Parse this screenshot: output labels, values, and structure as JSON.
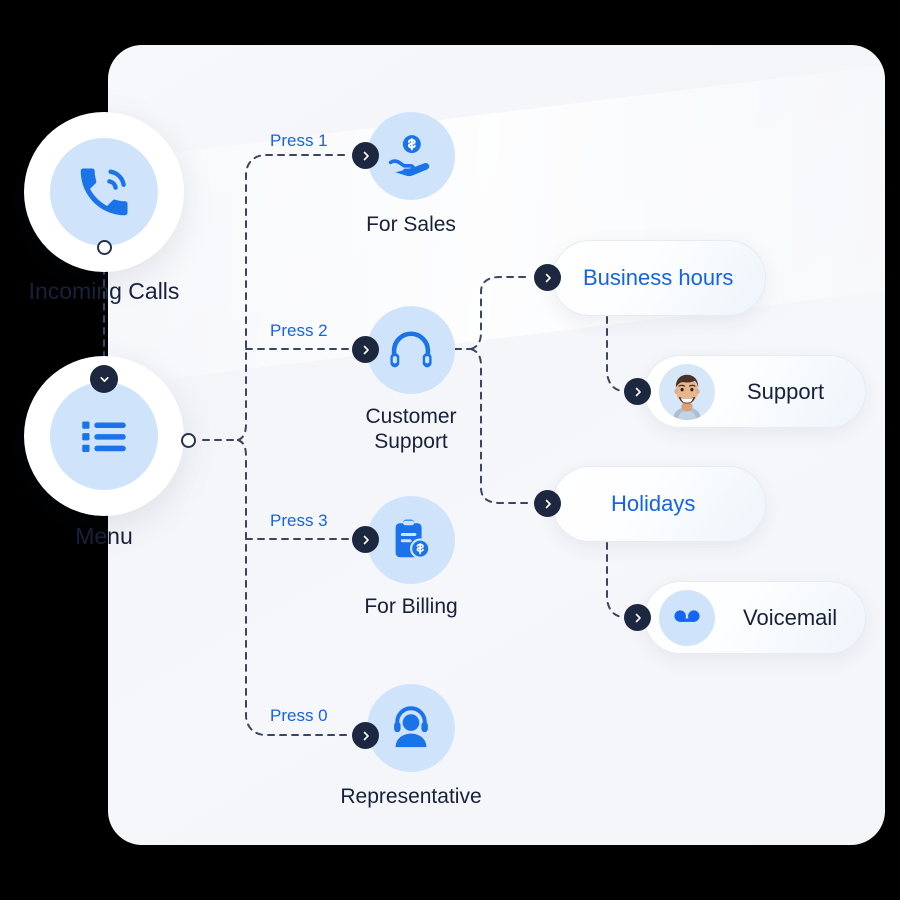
{
  "diagram": {
    "title": "IVR call flow",
    "colors": {
      "accent_blue": "#1664e0",
      "icon_blue": "#1a73e8",
      "icon_disc": "#cfe4fb",
      "badge_dark": "#1d2740",
      "text_dark": "#18213a",
      "canvas_bg": "#f4f6f9"
    }
  },
  "entry_nodes": [
    {
      "id": "incoming-calls",
      "label": "Incoming Calls",
      "icon": "phone-call-icon"
    },
    {
      "id": "menu",
      "label": "Menu",
      "icon": "list-menu-icon",
      "badge_icon": "chevron-down-icon"
    }
  ],
  "options": [
    {
      "id": "sales",
      "press": "Press 1",
      "label": "For Sales",
      "icon": "hand-holding-dollar-icon"
    },
    {
      "id": "customer-support",
      "press": "Press 2",
      "label": "Customer\nSupport",
      "icon": "headset-icon"
    },
    {
      "id": "billing",
      "press": "Press 3",
      "label": "For Billing",
      "icon": "clipboard-dollar-icon"
    },
    {
      "id": "representative",
      "press": "Press 0",
      "label": "Representative",
      "icon": "agent-headset-icon"
    }
  ],
  "pills": [
    {
      "id": "business-hours",
      "label": "Business hours",
      "style": "blue",
      "icon": null
    },
    {
      "id": "support",
      "label": "Support",
      "style": "dark",
      "icon": "avatar-photo"
    },
    {
      "id": "holidays",
      "label": "Holidays",
      "style": "blue",
      "icon": null
    },
    {
      "id": "voicemail",
      "label": "Voicemail",
      "style": "dark",
      "icon": "voicemail-icon"
    }
  ]
}
